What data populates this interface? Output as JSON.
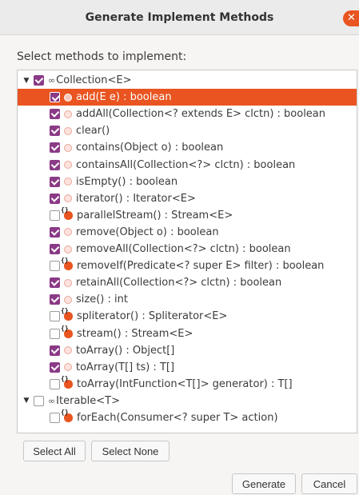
{
  "dialog": {
    "title": "Generate Implement Methods",
    "close_glyph": "✕",
    "instruction": "Select methods to implement:"
  },
  "tree": [
    {
      "type": "group",
      "expander": "▼",
      "checked": true,
      "icon": "interface",
      "label": "Collection<E>"
    },
    {
      "type": "method",
      "checked": true,
      "icon": "abstract",
      "label": "add(E e) : boolean",
      "selected": true
    },
    {
      "type": "method",
      "checked": true,
      "icon": "abstract",
      "label": "addAll(Collection<? extends E> clctn) : boolean"
    },
    {
      "type": "method",
      "checked": true,
      "icon": "abstract",
      "label": "clear()"
    },
    {
      "type": "method",
      "checked": true,
      "icon": "abstract",
      "label": "contains(Object o) : boolean"
    },
    {
      "type": "method",
      "checked": true,
      "icon": "abstract",
      "label": "containsAll(Collection<?> clctn) : boolean"
    },
    {
      "type": "method",
      "checked": true,
      "icon": "abstract",
      "label": "isEmpty() : boolean"
    },
    {
      "type": "method",
      "checked": true,
      "icon": "abstract",
      "label": "iterator() : Iterator<E>"
    },
    {
      "type": "method",
      "checked": false,
      "icon": "default",
      "label": "parallelStream() : Stream<E>"
    },
    {
      "type": "method",
      "checked": true,
      "icon": "abstract",
      "label": "remove(Object o) : boolean"
    },
    {
      "type": "method",
      "checked": true,
      "icon": "abstract",
      "label": "removeAll(Collection<?> clctn) : boolean"
    },
    {
      "type": "method",
      "checked": false,
      "icon": "default",
      "label": "removeIf(Predicate<? super E> filter) : boolean"
    },
    {
      "type": "method",
      "checked": true,
      "icon": "abstract",
      "label": "retainAll(Collection<?> clctn) : boolean"
    },
    {
      "type": "method",
      "checked": true,
      "icon": "abstract",
      "label": "size() : int"
    },
    {
      "type": "method",
      "checked": false,
      "icon": "default",
      "label": "spliterator() : Spliterator<E>"
    },
    {
      "type": "method",
      "checked": false,
      "icon": "default",
      "label": "stream() : Stream<E>"
    },
    {
      "type": "method",
      "checked": true,
      "icon": "abstract",
      "label": "toArray() : Object[]"
    },
    {
      "type": "method",
      "checked": true,
      "icon": "abstract",
      "label": "toArray(T[] ts) : T[]"
    },
    {
      "type": "method",
      "checked": false,
      "icon": "default",
      "label": "toArray(IntFunction<T[]> generator) : T[]"
    },
    {
      "type": "group",
      "expander": "▼",
      "checked": false,
      "icon": "interface",
      "label": "Iterable<T>"
    },
    {
      "type": "method",
      "checked": false,
      "icon": "default",
      "label": "forEach(Consumer<? super T> action)"
    }
  ],
  "buttons": {
    "select_all": "Select All",
    "select_none": "Select None",
    "generate": "Generate",
    "cancel": "Cancel"
  },
  "colors": {
    "accent": "#e95420",
    "checkbox": "#8a3a86"
  }
}
